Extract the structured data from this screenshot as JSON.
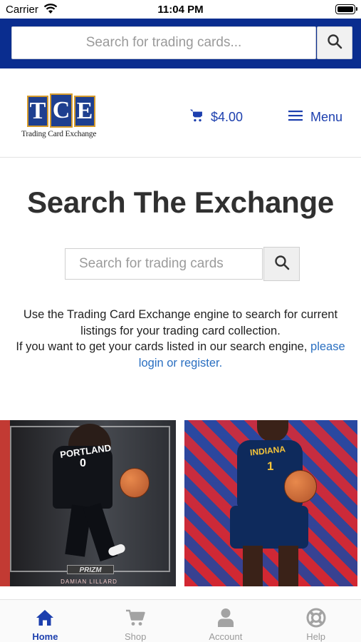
{
  "status_bar": {
    "carrier": "Carrier",
    "time": "11:04 PM"
  },
  "top_search": {
    "placeholder": "Search for trading cards..."
  },
  "header": {
    "logo_letters": [
      "T",
      "C",
      "E"
    ],
    "logo_tagline": "Trading Card Exchange",
    "cart_total": "$4.00",
    "menu_label": "Menu"
  },
  "main": {
    "title": "Search The Exchange",
    "search_placeholder": "Search for trading cards",
    "description_line1": "Use the Trading Card Exchange engine to search for current listings for your trading card collection.",
    "description_line2": "If you want to get your cards listed in our search engine,",
    "login_link": "please login or register."
  },
  "cards": [
    {
      "team_text": "PORTLAND",
      "number": "0",
      "brand": "PRIZM",
      "player_name": "DAMIAN LILLARD"
    },
    {
      "team_text": "INDIANA",
      "number": "1"
    }
  ],
  "tabs": [
    {
      "label": "Home",
      "icon": "home-icon",
      "active": true
    },
    {
      "label": "Shop",
      "icon": "cart-icon",
      "active": false
    },
    {
      "label": "Account",
      "icon": "user-icon",
      "active": false
    },
    {
      "label": "Help",
      "icon": "lifebuoy-icon",
      "active": false
    }
  ],
  "colors": {
    "banner": "#0a2d8f",
    "accent": "#1c3fae",
    "link": "#2a6fc1",
    "logo_tile": "#1e3f8f",
    "logo_border": "#d59b2b"
  }
}
